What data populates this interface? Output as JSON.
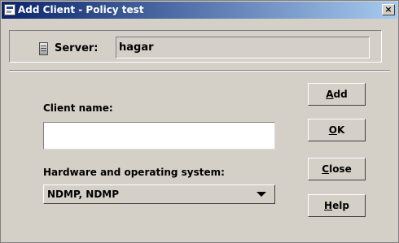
{
  "window": {
    "title": "Add Client - Policy test",
    "close_label": "×"
  },
  "server": {
    "label": "Server:",
    "value": "hagar"
  },
  "form": {
    "client_name_label": "Client name:",
    "client_name_value": "",
    "hardware_label": "Hardware and operating system:",
    "hardware_value": "NDMP, NDMP"
  },
  "buttons": [
    {
      "mnemonic": "A",
      "rest": "dd"
    },
    {
      "mnemonic": "O",
      "rest": "K"
    },
    {
      "mnemonic": "C",
      "rest": "lose"
    },
    {
      "mnemonic": "H",
      "rest": "elp"
    }
  ]
}
